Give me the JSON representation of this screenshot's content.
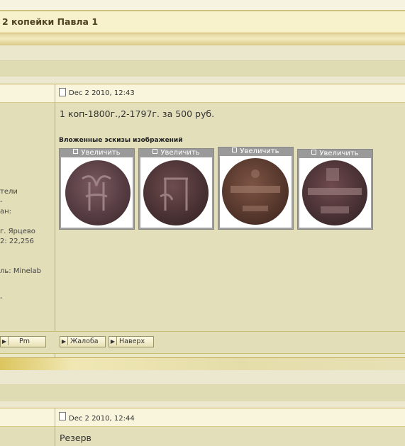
{
  "topic": {
    "title": "2 копейки Павла 1"
  },
  "post1": {
    "date": "Dec 2 2010, 12:43",
    "profile_lines": [
      "тели",
      "-",
      "ан:",
      "г. Ярцево",
      "2: 22,256",
      "ль: Minelab",
      "-"
    ],
    "text": "1 коп-1800г.,2-1797г. за 500 руб.",
    "attachments_label": "Вложенные эскизы изображений",
    "enlarge_label": "Увеличить",
    "thumbnails": [
      "coin-1800-monogram",
      "coin-1797-monogram",
      "coin-1800-reverse",
      "coin-1797-reverse"
    ],
    "buttons": {
      "pm": "Pm",
      "complaint": "Жалоба",
      "top": "Наверх"
    }
  },
  "post2": {
    "date": "Dec 2 2010, 12:44",
    "text": "Резерв"
  },
  "colors": {
    "background": "#ebe8c8",
    "title_bar": "#f7f1cc",
    "gold_accent": "#c7b25b",
    "thumb_frame": "#9a9a9a"
  }
}
